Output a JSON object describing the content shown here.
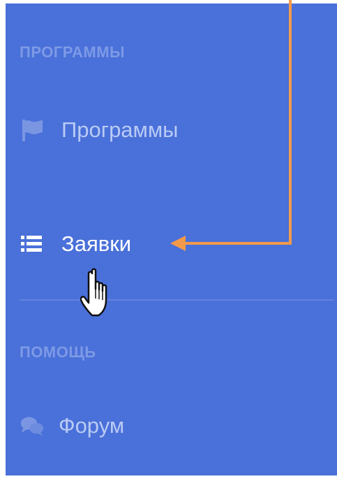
{
  "sidebar": {
    "sections": [
      {
        "title": "ПРОГРАММЫ",
        "items": [
          {
            "label": "Программы",
            "icon": "flag-icon"
          },
          {
            "label": "Заявки",
            "icon": "list-icon",
            "active": true
          }
        ]
      },
      {
        "title": "ПОМОЩЬ",
        "items": [
          {
            "label": "Форум",
            "icon": "chat-bubbles-icon"
          }
        ]
      }
    ]
  },
  "annotation": {
    "arrow_color": "#f39a4a",
    "pointer": "hand-cursor-icon"
  },
  "colors": {
    "sidebar_bg": "#4a70d9",
    "section_title": "#7d9ae6",
    "item_text": "#b9cbf5",
    "active_text": "#ffffff",
    "icon_color": "#7a96e3"
  }
}
